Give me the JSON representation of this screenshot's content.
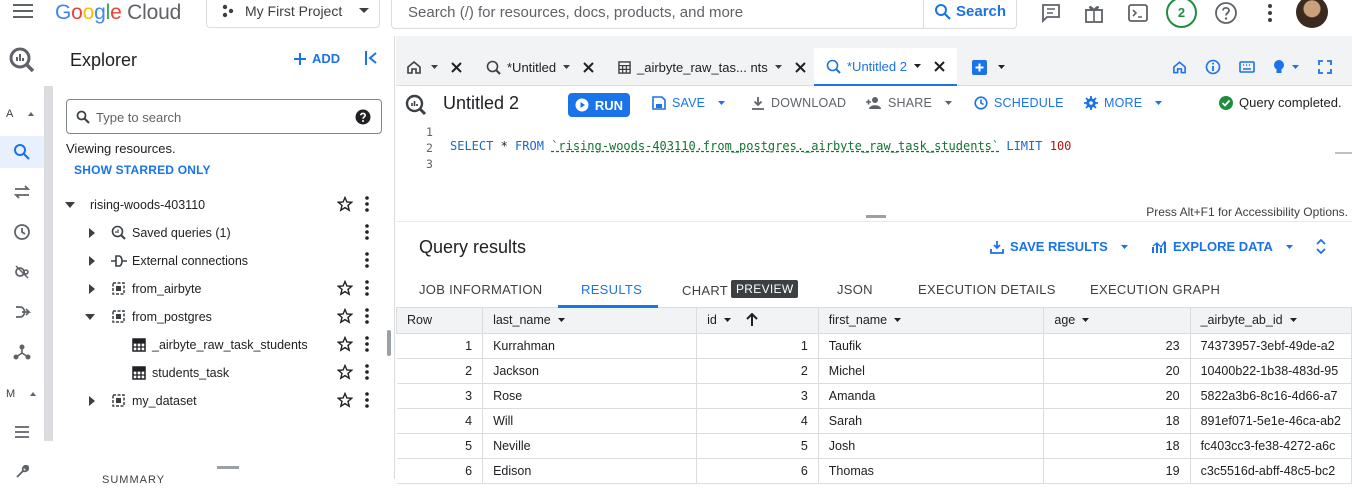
{
  "app": {
    "brand": "Google Cloud",
    "colors": {
      "accent": "#1a73e8",
      "success": "#1e8e3e"
    }
  },
  "topbar": {
    "project": "My First Project",
    "search_placeholder": "Search (/) for resources, docs, products, and more",
    "search_button": "Search",
    "notifications_count": "2"
  },
  "rail": {
    "items": [
      {
        "label": "A"
      },
      {
        "label": "M"
      }
    ]
  },
  "explorer": {
    "title": "Explorer",
    "add_label": "ADD",
    "search_placeholder": "Type to search",
    "viewing_text": "Viewing resources.",
    "show_starred": "SHOW STARRED ONLY",
    "project": "rising-woods-403110",
    "items": [
      {
        "label": "Saved queries (1)"
      },
      {
        "label": "External connections"
      },
      {
        "label": "from_airbyte"
      },
      {
        "label": "from_postgres"
      },
      {
        "label": "_airbyte_raw_task_students"
      },
      {
        "label": "students_task"
      },
      {
        "label": "my_dataset"
      }
    ],
    "summary_label": "SUMMARY"
  },
  "tabs": [
    {
      "label": "*Untitled"
    },
    {
      "label": "_airbyte_raw_tas... nts"
    },
    {
      "label": "*Untitled 2"
    }
  ],
  "editor": {
    "title": "Untitled 2",
    "run": "RUN",
    "save": "SAVE",
    "download": "DOWNLOAD",
    "share": "SHARE",
    "schedule": "SCHEDULE",
    "more": "MORE",
    "status": "Query completed.",
    "line_numbers": [
      "1",
      "2",
      "3"
    ],
    "code": {
      "kw1": "SELECT",
      "mid": " * ",
      "kw2": "FROM",
      "table": "`rising-woods-403110.from_postgres._airbyte_raw_task_students`",
      "kw3": "LIMIT",
      "limit": "100"
    },
    "a11y_hint": "Press Alt+F1 for Accessibility Options."
  },
  "results": {
    "title": "Query results",
    "save_results": "SAVE RESULTS",
    "explore_data": "EXPLORE DATA",
    "tabs": [
      {
        "label": "JOB INFORMATION"
      },
      {
        "label": "RESULTS"
      },
      {
        "label": "CHART"
      },
      {
        "label": "JSON"
      },
      {
        "label": "EXECUTION DETAILS"
      },
      {
        "label": "EXECUTION GRAPH"
      }
    ],
    "preview_badge": "PREVIEW",
    "columns": [
      "Row",
      "last_name",
      "id",
      "first_name",
      "age",
      "_airbyte_ab_id"
    ],
    "rows": [
      [
        "1",
        "Kurrahman",
        "1",
        "Taufik",
        "23",
        "74373957-3ebf-49de-a2"
      ],
      [
        "2",
        "Jackson",
        "2",
        "Michel",
        "20",
        "10400b22-1b38-483d-95"
      ],
      [
        "3",
        "Rose",
        "3",
        "Amanda",
        "20",
        "5822a3b6-8c16-4d66-a7"
      ],
      [
        "4",
        "Will",
        "4",
        "Sarah",
        "18",
        "891ef071-5e1e-46ca-ab2"
      ],
      [
        "5",
        "Neville",
        "5",
        "Josh",
        "18",
        "fc403cc3-fe38-4272-a6c"
      ],
      [
        "6",
        "Edison",
        "6",
        "Thomas",
        "19",
        "c3c5516d-abff-48c5-bc2"
      ]
    ]
  }
}
